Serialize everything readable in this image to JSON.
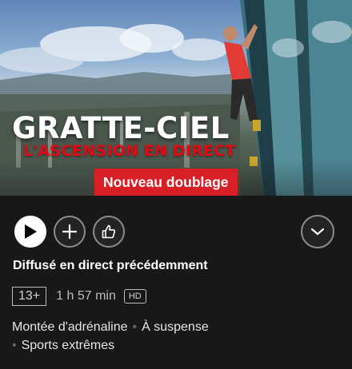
{
  "hero": {
    "title": "GRATTE-CIEL",
    "subtitle": "L'ASCENSION EN DIRECT",
    "badge": "Nouveau doublage"
  },
  "actions": {
    "play": "play-icon",
    "add": "plus-icon",
    "like": "thumbs-up-icon",
    "more": "chevron-down-icon"
  },
  "status": "Diffusé en direct précédemment",
  "meta": {
    "rating": "13+",
    "duration": "1 h 57 min",
    "quality": "HD"
  },
  "tags": {
    "separator": "•",
    "items": [
      "Montée d'adrénaline",
      "À suspense",
      "Sports extrêmes"
    ]
  },
  "colors": {
    "background": "#181818",
    "accent": "#e50914",
    "badge": "#d81f26"
  }
}
